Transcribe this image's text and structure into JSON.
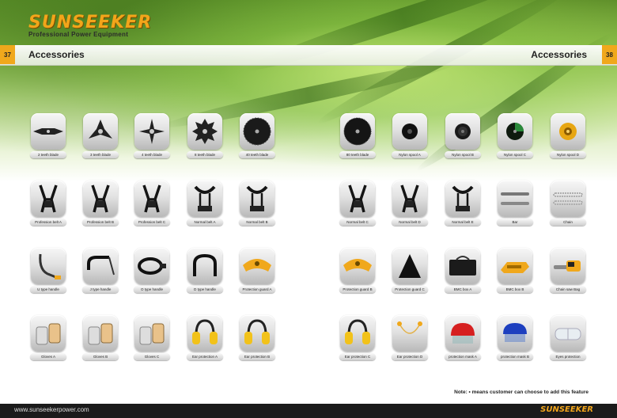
{
  "brand": {
    "name": "SUNSEEKER",
    "tagline": "Professional Power Equipment"
  },
  "left_page": {
    "number": "37",
    "title": "Accessories"
  },
  "right_page": {
    "number": "38",
    "title": "Accessories"
  },
  "items": [
    {
      "label": "2 teeth blade",
      "icon": "two-teeth-blade"
    },
    {
      "label": "3 teeth blade",
      "icon": "three-teeth-blade"
    },
    {
      "label": "4 teeth blade",
      "icon": "four-teeth-blade"
    },
    {
      "label": "8 teeth blade",
      "icon": "eight-teeth-blade"
    },
    {
      "label": "40 teeth blade",
      "icon": "forty-teeth-blade"
    },
    {
      "label": "80 teeth blade",
      "icon": "eighty-teeth-blade"
    },
    {
      "label": "Nylon spool A",
      "icon": "nylon-spool-a"
    },
    {
      "label": "Nylon spool B",
      "icon": "nylon-spool-b"
    },
    {
      "label": "Nylon spool C",
      "icon": "nylon-spool-c"
    },
    {
      "label": "Nylon spool D",
      "icon": "nylon-spool-d"
    },
    {
      "label": "Profession belt A",
      "icon": "harness-belt"
    },
    {
      "label": "Profession belt B",
      "icon": "harness-belt"
    },
    {
      "label": "Profession belt C",
      "icon": "harness-belt"
    },
    {
      "label": "Normal belt A",
      "icon": "shoulder-strap"
    },
    {
      "label": "Normal belt B",
      "icon": "shoulder-strap"
    },
    {
      "label": "Normal belt C",
      "icon": "harness-belt"
    },
    {
      "label": "Normal belt D",
      "icon": "harness-belt"
    },
    {
      "label": "Normal belt E",
      "icon": "shoulder-strap"
    },
    {
      "label": "Bar",
      "icon": "chainsaw-bar"
    },
    {
      "label": "Chain",
      "icon": "saw-chain"
    },
    {
      "label": "U type handle",
      "icon": "u-handle"
    },
    {
      "label": "J type handle",
      "icon": "j-handle"
    },
    {
      "label": "O type handle",
      "icon": "o-handle"
    },
    {
      "label": "D type handle",
      "icon": "d-handle"
    },
    {
      "label": "Protection guard A",
      "icon": "protection-guard"
    },
    {
      "label": "Protection guard B",
      "icon": "protection-guard"
    },
    {
      "label": "Protection guard C",
      "icon": "cone-guard"
    },
    {
      "label": "BMC box A",
      "icon": "tool-bag"
    },
    {
      "label": "BMC box B",
      "icon": "chainsaw-case"
    },
    {
      "label": "Chain saw Bag",
      "icon": "chainsaw"
    },
    {
      "label": "Gloves A",
      "icon": "gloves"
    },
    {
      "label": "Gloves B",
      "icon": "gloves"
    },
    {
      "label": "Gloves C",
      "icon": "gloves"
    },
    {
      "label": "Ear protection A",
      "icon": "earmuffs"
    },
    {
      "label": "Ear protection B",
      "icon": "earmuffs"
    },
    {
      "label": "Ear protection C",
      "icon": "earmuffs"
    },
    {
      "label": "Ear protection D",
      "icon": "earplugs"
    },
    {
      "label": "protection mask A",
      "icon": "safety-helmet"
    },
    {
      "label": "protection mask B",
      "icon": "visor-helmet"
    },
    {
      "label": "Eyes protection",
      "icon": "goggles"
    }
  ],
  "note": "Note: • means customer can choose to add this feature",
  "footer": {
    "url": "www.sunseekerpower.com",
    "brand": "SUNSEEKER"
  },
  "colors": {
    "accent": "#f0a81c",
    "footer_bg": "#1b1b1b"
  }
}
